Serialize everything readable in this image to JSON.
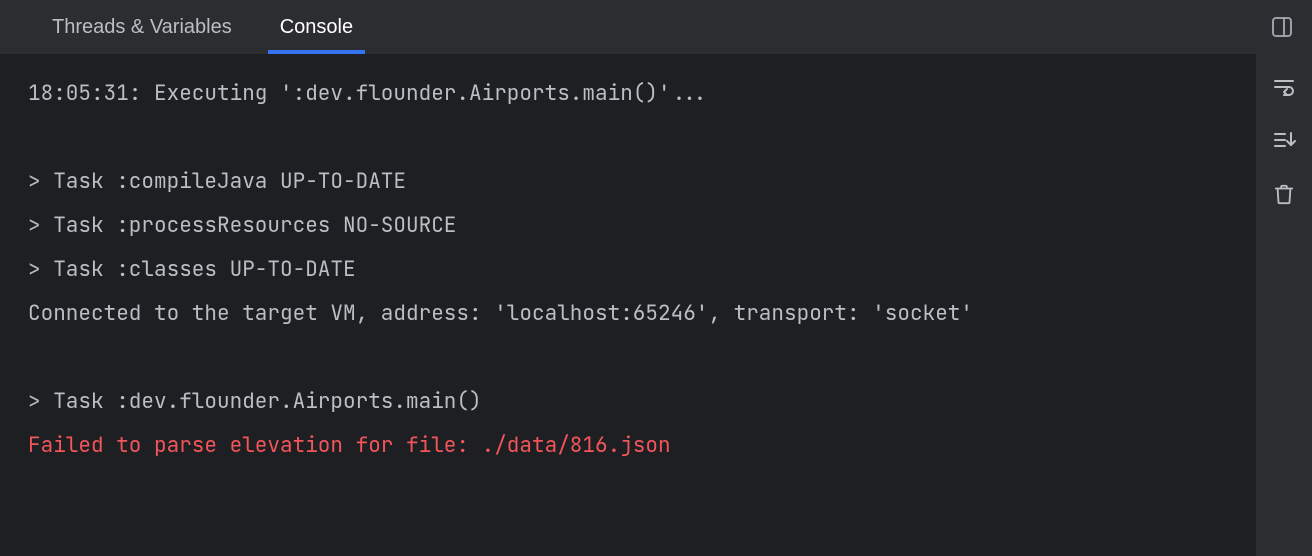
{
  "tabs": {
    "threads": "Threads & Variables",
    "console": "Console"
  },
  "console": {
    "l1": "18:05:31: Executing ':dev.flounder.Airports.main()'...",
    "l2": "",
    "l3": "> Task :compileJava UP-TO-DATE",
    "l4": "> Task :processResources NO-SOURCE",
    "l5": "> Task :classes UP-TO-DATE",
    "l6": "Connected to the target VM, address: 'localhost:65246', transport: 'socket'",
    "l7": "",
    "l8": "> Task :dev.flounder.Airports.main()",
    "l9": "Failed to parse elevation for file: ./data/816.json"
  }
}
